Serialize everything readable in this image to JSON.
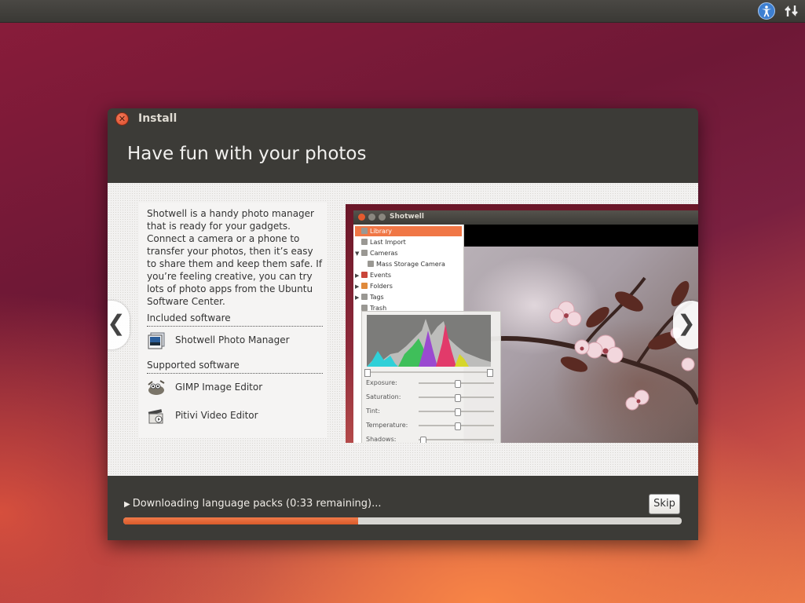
{
  "panel": {
    "accessibility_icon": "accessibility-icon",
    "network_icon": "network-icon"
  },
  "window": {
    "title": "Install"
  },
  "slide": {
    "title": "Have fun with your photos",
    "description": "Shotwell is a handy photo manager that is ready for your gadgets. Connect a camera or a phone to transfer your photos, then it’s easy to share them and keep them safe. If you’re feeling creative, you can try lots of photo apps from the Ubuntu Software Center.",
    "included_heading": "Included software",
    "included": [
      {
        "name": "Shotwell Photo Manager",
        "icon": "shotwell-icon"
      }
    ],
    "supported_heading": "Supported software",
    "supported": [
      {
        "name": "GIMP Image Editor",
        "icon": "gimp-icon"
      },
      {
        "name": "Pitivi Video Editor",
        "icon": "pitivi-icon"
      }
    ],
    "prev": "❮",
    "next": "❯"
  },
  "screenshot": {
    "window_title": "Shotwell",
    "sidebar": [
      {
        "label": "Library",
        "selected": true
      },
      {
        "label": "Last Import"
      },
      {
        "label": "Cameras",
        "expanded": true
      },
      {
        "label": "Mass Storage Camera",
        "indent": true
      },
      {
        "label": "Events",
        "collapsed": true
      },
      {
        "label": "Folders",
        "collapsed": true
      },
      {
        "label": "Tags",
        "collapsed": true
      },
      {
        "label": "Trash"
      }
    ],
    "adjustments": [
      {
        "label": "Exposure:",
        "value": 0.5
      },
      {
        "label": "Saturation:",
        "value": 0.5
      },
      {
        "label": "Tint:",
        "value": 0.5
      },
      {
        "label": "Temperature:",
        "value": 0.5
      },
      {
        "label": "Shadows:",
        "value": 0.05
      }
    ]
  },
  "progress": {
    "status": "Downloading language packs (0:33 remaining)...",
    "fraction": 0.42,
    "skip_label": "Skip"
  },
  "colors": {
    "accent": "#dd4814",
    "window_bg": "#3c3b37"
  }
}
